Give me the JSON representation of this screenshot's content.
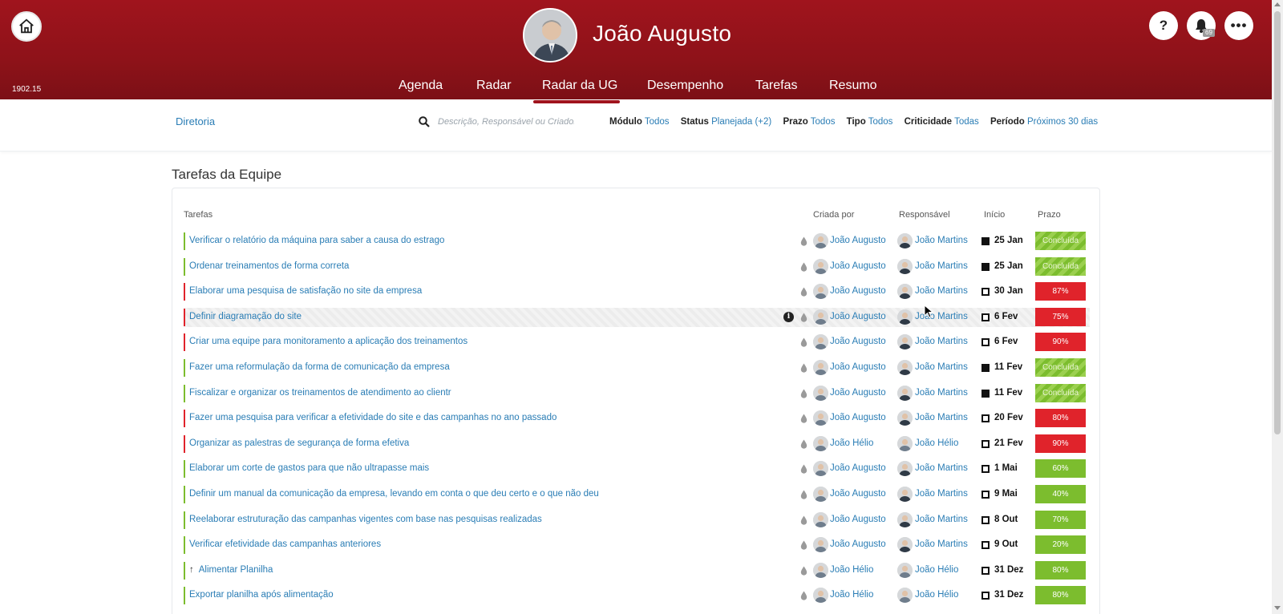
{
  "app": {
    "version": "1902.15",
    "user_name": "João Augusto",
    "notifications_count": "69"
  },
  "nav": {
    "items": [
      "Agenda",
      "Radar",
      "Radar da UG",
      "Desempenho",
      "Tarefas",
      "Resumo"
    ],
    "active": "Radar da UG"
  },
  "filterbar": {
    "diretoria": "Diretoria",
    "search_placeholder": "Descrição, Responsável ou Criador",
    "filters": [
      {
        "label": "Módulo",
        "value": "Todos"
      },
      {
        "label": "Status",
        "value": "Planejada (+2)"
      },
      {
        "label": "Prazo",
        "value": "Todos"
      },
      {
        "label": "Tipo",
        "value": "Todos"
      },
      {
        "label": "Criticidade",
        "value": "Todas"
      },
      {
        "label": "Período",
        "value": "Próximos 30 dias"
      }
    ]
  },
  "section": {
    "title": "Tarefas da Equipe",
    "headers": {
      "tarefas": "Tarefas",
      "criada_por": "Criada por",
      "responsavel": "Responsável",
      "inicio": "Início",
      "prazo": "Prazo"
    }
  },
  "colors": {
    "header_red": "#a0141d",
    "link_blue": "#2a7db5",
    "late_red": "#e0232b",
    "ok_green": "#7cbd2e"
  },
  "tasks": [
    {
      "title": "Verificar o relatório da máquina para saber a causa do estrago",
      "bar": "green",
      "creator": "João Augusto",
      "responsible": "João Martins",
      "start": "25 Jan",
      "start_filled": true,
      "prazo": "Concluída",
      "status": "done"
    },
    {
      "title": "Ordenar treinamentos de forma correta",
      "bar": "green",
      "creator": "João Augusto",
      "responsible": "João Martins",
      "start": "25 Jan",
      "start_filled": true,
      "prazo": "Concluída",
      "status": "done"
    },
    {
      "title": "Elaborar uma pesquisa de satisfação no site da empresa",
      "bar": "red",
      "creator": "João Augusto",
      "responsible": "João Martins",
      "start": "30 Jan",
      "start_filled": false,
      "prazo": "87%",
      "status": "red"
    },
    {
      "title": "Definir diagramação do site",
      "bar": "red",
      "creator": "João Augusto",
      "responsible": "João Martins",
      "start": "6 Fev",
      "start_filled": false,
      "prazo": "75%",
      "status": "red",
      "hover": true
    },
    {
      "title": "Criar uma equipe para monitoramento a aplicação dos treinamentos",
      "bar": "red",
      "creator": "João Augusto",
      "responsible": "João Martins",
      "start": "6 Fev",
      "start_filled": false,
      "prazo": "90%",
      "status": "red"
    },
    {
      "title": "Fazer uma reformulação da forma de comunicação da empresa",
      "bar": "green",
      "creator": "João Augusto",
      "responsible": "João Martins",
      "start": "11 Fev",
      "start_filled": true,
      "prazo": "Concluída",
      "status": "done"
    },
    {
      "title": "Fiscalizar e organizar os treinamentos de atendimento ao clientr",
      "bar": "green",
      "creator": "João Augusto",
      "responsible": "João Martins",
      "start": "11 Fev",
      "start_filled": true,
      "prazo": "Concluída",
      "status": "done"
    },
    {
      "title": "Fazer uma pesquisa para verificar a efetividade do site e das campanhas no ano passado",
      "bar": "red",
      "creator": "João Augusto",
      "responsible": "João Martins",
      "start": "20 Fev",
      "start_filled": false,
      "prazo": "80%",
      "status": "red"
    },
    {
      "title": "Organizar as palestras de segurança de forma efetiva",
      "bar": "red",
      "creator": "João Hélio",
      "responsible": "João Hélio",
      "start": "21 Fev",
      "start_filled": false,
      "prazo": "90%",
      "status": "red"
    },
    {
      "title": "Elaborar um corte de gastos para que não ultrapasse mais",
      "bar": "green",
      "creator": "João Augusto",
      "responsible": "João Martins",
      "start": "1 Mai",
      "start_filled": false,
      "prazo": "60%",
      "status": "green"
    },
    {
      "title": "Definir um manual da comunicação da empresa, levando em conta o que deu certo e o que não deu",
      "bar": "green",
      "creator": "João Augusto",
      "responsible": "João Martins",
      "start": "9 Mai",
      "start_filled": false,
      "prazo": "40%",
      "status": "green"
    },
    {
      "title": "Reelaborar estruturação das campanhas vigentes com base nas pesquisas realizadas",
      "bar": "green",
      "creator": "João Augusto",
      "responsible": "João Martins",
      "start": "8 Out",
      "start_filled": false,
      "prazo": "70%",
      "status": "green"
    },
    {
      "title": "Verificar efetividade das campanhas anteriores",
      "bar": "green",
      "creator": "João Augusto",
      "responsible": "João Martins",
      "start": "9 Out",
      "start_filled": false,
      "prazo": "20%",
      "status": "green"
    },
    {
      "title": "Alimentar Planilha",
      "bar": "green",
      "creator": "João Hélio",
      "responsible": "João Hélio",
      "start": "31 Dez",
      "start_filled": false,
      "prazo": "80%",
      "status": "green",
      "arrow": true
    },
    {
      "title": "Exportar planilha após alimentação",
      "bar": "green",
      "creator": "João Hélio",
      "responsible": "João Hélio",
      "start": "31 Dez",
      "start_filled": false,
      "prazo": "80%",
      "status": "green"
    }
  ]
}
